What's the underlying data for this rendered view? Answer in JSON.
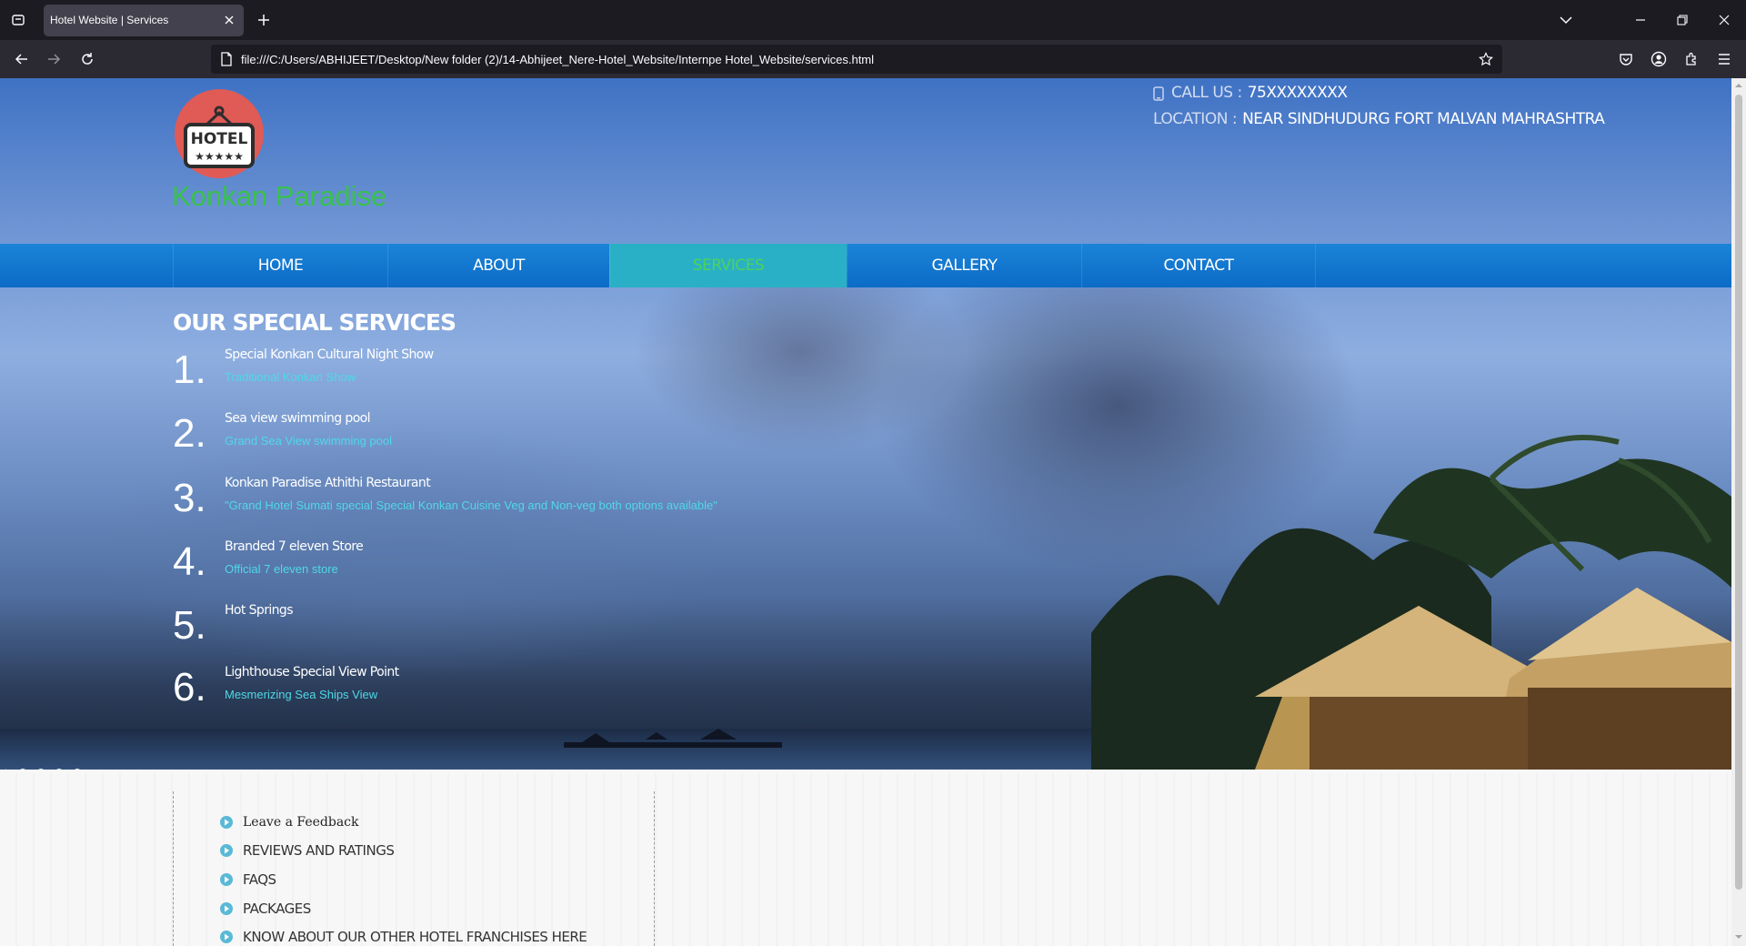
{
  "browser": {
    "tab_title": "Hotel Website | Services",
    "url": "file:///C:/Users/ABHIJEET/Desktop/New folder (2)/14-Abhijeet_Nere-Hotel_Website/Internpe Hotel_Website/services.html"
  },
  "header": {
    "logo_text": "HOTEL",
    "logo_stars": "★★★★★",
    "site_name": "Konkan Paradise",
    "call_label": "CALL US :",
    "call_value": "75XXXXXXXX",
    "location_label": "LOCATION :",
    "location_value": "NEAR SINDHUDURG FORT MALVAN MAHRASHTRA"
  },
  "menu": {
    "items": [
      {
        "label": "HOME"
      },
      {
        "label": "ABOUT"
      },
      {
        "label": "SERVICES"
      },
      {
        "label": "GALLERY"
      },
      {
        "label": "CONTACT"
      }
    ],
    "active": "SERVICES"
  },
  "services": {
    "title": "OUR SPECIAL SERVICES",
    "items": [
      {
        "num": "1.",
        "title": "Special Konkan Cultural Night Show",
        "sub": "Traditional Konkan Show"
      },
      {
        "num": "2.",
        "title": "Sea view swimming pool",
        "sub": "Grand Sea View swimming pool"
      },
      {
        "num": "3.",
        "title": "Konkan Paradise Athithi Restaurant",
        "sub": "\"Grand Hotel Sumati special Special Konkan Cuisine Veg and Non-veg both options available\""
      },
      {
        "num": "4.",
        "title": "Branded 7 eleven Store",
        "sub": "Official 7 eleven store"
      },
      {
        "num": "5.",
        "title": "Hot Springs",
        "sub": ""
      },
      {
        "num": "6.",
        "title": "Lighthouse Special View Point",
        "sub": "Mesmerizing Sea Ships View"
      }
    ]
  },
  "footer": {
    "links": [
      {
        "label": "Leave a Feedback"
      },
      {
        "label": "REVIEWS AND RATINGS"
      },
      {
        "label": "FAQS"
      },
      {
        "label": "PACKAGES"
      },
      {
        "label": "KNOW ABOUT OUR OTHER HOTEL FRANCHISES HERE"
      }
    ]
  },
  "colors": {
    "menu_bg": "#0c6bc6",
    "menu_active_bg": "#2ab0c6",
    "brand_green": "#38c24c",
    "subtitle_cyan": "#4fd8e6",
    "logo_red": "#e05a56"
  }
}
